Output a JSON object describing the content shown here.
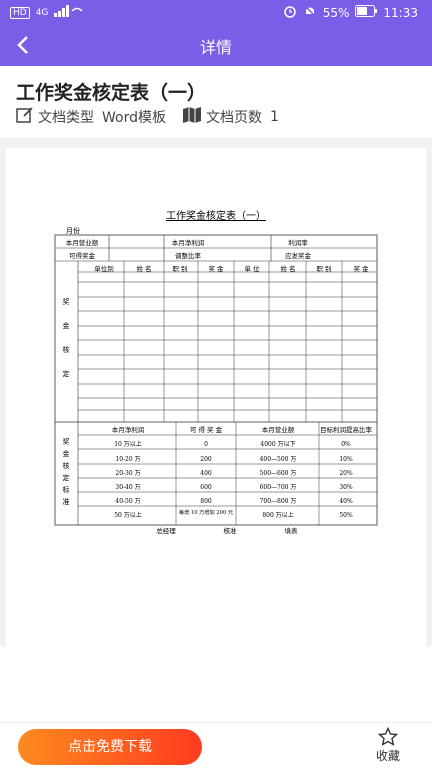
{
  "status": {
    "left_labels": [
      "HD",
      "4G"
    ],
    "battery": "55%",
    "time": "11:33"
  },
  "appbar": {
    "title": "详情"
  },
  "document": {
    "title": "工作奖金核定表（一）",
    "type_label": "文档类型",
    "type_value": "Word模板",
    "pages_label": "文档页数",
    "pages_value": "1"
  },
  "form": {
    "title": "工作奖金核定表（一）",
    "month_label": "月份",
    "row1": [
      "本月营业额",
      "本月净利润",
      "利润率"
    ],
    "row2": [
      "可得奖金",
      "调整比率",
      "应发奖金"
    ],
    "bonus_section_label": [
      "奖",
      "金",
      "核",
      "定"
    ],
    "columns": [
      "单位别",
      "姓 名",
      "职 别",
      "奖 金",
      "单 位",
      "姓 名",
      "职 别",
      "奖 金"
    ],
    "standard_section_label": [
      "奖",
      "金",
      "核",
      "定",
      "标",
      "准"
    ],
    "standard_headers": [
      "本月净利润",
      "可 得 奖 金",
      "本月营业额",
      "目标利润提高比率"
    ],
    "standard_rows": [
      [
        "10 万以上",
        "0",
        "4000 万以下",
        "0%"
      ],
      [
        "10-20 万",
        "200",
        "400—500 万",
        "10%"
      ],
      [
        "20-30 万",
        "400",
        "500—600 万",
        "20%"
      ],
      [
        "30-40 万",
        "600",
        "600—700 万",
        "30%"
      ],
      [
        "40-50 万",
        "800",
        "700—800 万",
        "40%"
      ],
      [
        "50 万以上",
        "每增 10 万增加 200 元",
        "800 万以上",
        "50%"
      ]
    ],
    "signatures": [
      "总经理",
      "核准",
      "填表"
    ]
  },
  "footer": {
    "download_label": "点击免费下载",
    "favorite_label": "收藏"
  }
}
